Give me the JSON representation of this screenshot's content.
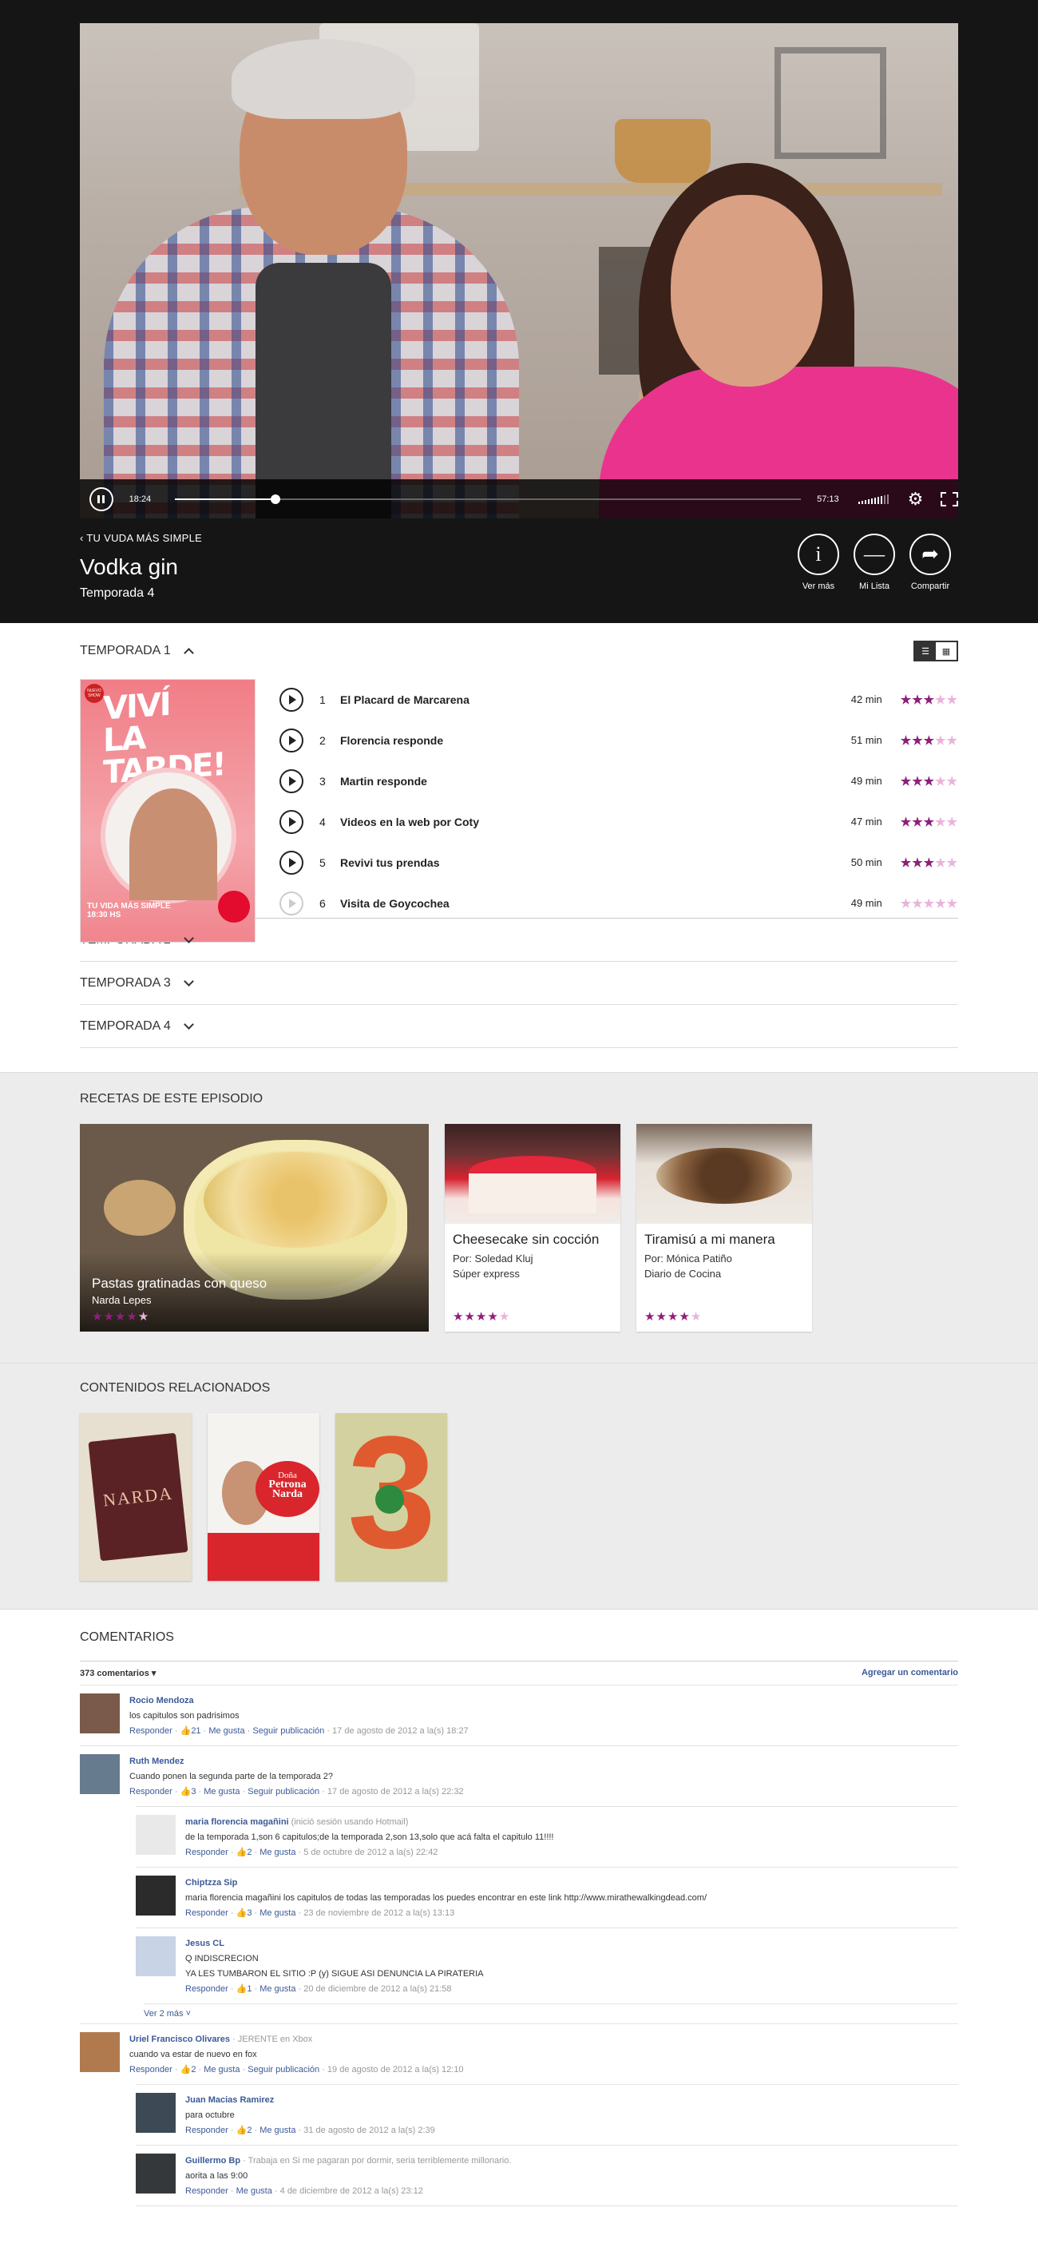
{
  "player": {
    "current_time": "18:24",
    "total_time": "57:13",
    "progress_fraction": 0.16
  },
  "show": {
    "back_label": "TU VUDA MÁS SIMPLE",
    "title": "Vodka gin",
    "season": "Temporada 4",
    "actions": [
      {
        "icon": "info-icon",
        "label": "Ver más"
      },
      {
        "icon": "minus-icon",
        "label": "Mi Lista"
      },
      {
        "icon": "share-icon",
        "label": "Compartir"
      }
    ]
  },
  "seasons": {
    "open_label": "TEMPORADA 1",
    "poster": {
      "badge": "NUEVO SHOW",
      "title_line1": "VIVÍ",
      "title_line2": "LA TARDE!",
      "footer_line1": "TU VIDA MÁS SIMPLE",
      "footer_line2": "18:30 HS"
    },
    "episodes": [
      {
        "num": "1",
        "name": "El Placard de Marcarena",
        "duration": "42 min",
        "rating": 3
      },
      {
        "num": "2",
        "name": "Florencia responde",
        "duration": "51 min",
        "rating": 3
      },
      {
        "num": "3",
        "name": "Martin responde",
        "duration": "49 min",
        "rating": 3
      },
      {
        "num": "4",
        "name": "Videos en la web por Coty",
        "duration": "47 min",
        "rating": 3
      },
      {
        "num": "5",
        "name": "Revivi tus prendas",
        "duration": "50 min",
        "rating": 3
      },
      {
        "num": "6",
        "name": "Visita de Goycochea",
        "duration": "49 min",
        "rating": 0
      }
    ],
    "collapsed": [
      "TEMPORADA 2",
      "TEMPORADA 3",
      "TEMPORADA 4"
    ]
  },
  "recipes": {
    "title": "RECETAS DE ESTE EPISODIO",
    "featured": {
      "name": "Pastas gratinadas con queso",
      "author": "Narda Lepes",
      "rating": 4
    },
    "cards": [
      {
        "name": "Cheesecake sin cocción",
        "author": "Por: Soledad Kluj",
        "source": "Súper express",
        "rating": 4
      },
      {
        "name": "Tiramisú a mi manera",
        "author": "Por: Mónica Patiño",
        "source": "Diario de Cocina",
        "rating": 4
      }
    ]
  },
  "related": {
    "title": "CONTENIDOS RELACIONADOS",
    "items": [
      {
        "label": "NARDA"
      },
      {
        "label1": "Doña",
        "label2": "Petrona",
        "label3": "Narda"
      },
      {
        "label": "3"
      }
    ]
  },
  "comments": {
    "title": "COMENTARIOS",
    "count": "373 comentarios ▾",
    "add_label": "Agregar un comentario",
    "responder": "Responder",
    "me_gusta": "Me gusta",
    "seguir": "Seguir publicación",
    "more_label": "Ver 2 más ˅",
    "items": [
      {
        "name": "Rocio Mendoza",
        "meta": "",
        "text": "los capitulos son padrisimos",
        "likes": "21",
        "date": "17 de agosto de 2012 a la(s) 18:27",
        "reply": false,
        "follow": true,
        "color": "#7a5a4a"
      },
      {
        "name": "Ruth Mendez",
        "meta": "",
        "text": "Cuando ponen la segunda parte de la temporada 2?",
        "likes": "3",
        "date": "17 de agosto de 2012 a la(s) 22:32",
        "reply": false,
        "follow": true,
        "color": "#667c8e"
      },
      {
        "name": "maria florencia magañini",
        "meta": "(inició sesión usando Hotmail)",
        "text": "de la temporada 1,son 6 capitulos;de la temporada 2,son 13,solo que acá falta el capitulo 11!!!!",
        "likes": "2",
        "date": "5 de octubre de 2012 a la(s) 22:42",
        "reply": true,
        "follow": false,
        "color": "#e9e9e9"
      },
      {
        "name": "Chiptzza Sip",
        "meta": "",
        "text": "maria florencia magañini los capitulos de todas las temporadas los puedes encontrar en este link http://www.mirathewalkingdead.com/",
        "likes": "3",
        "date": "23 de noviembre de 2012 a la(s) 13:13",
        "reply": true,
        "follow": false,
        "color": "#2b2b2b"
      },
      {
        "name": "Jesus CL",
        "meta": "",
        "text": "Q INDISCRECION\nYA LES TUMBARON EL SITIO :P (y) SIGUE ASI DENUNCIA LA PIRATERIA",
        "likes": "1",
        "date": "20 de diciembre de 2012 a la(s) 21:58",
        "reply": true,
        "follow": false,
        "color": "#c9d3e6"
      },
      {
        "name": "Uriel Francisco Olivares",
        "meta": "· JERENTE en Xbox",
        "text": "cuando va estar de nuevo en fox",
        "likes": "2",
        "date": "19 de agosto de 2012 a la(s) 12:10",
        "reply": false,
        "follow": true,
        "color": "#b07a4e"
      },
      {
        "name": "Juan Macias Ramirez",
        "meta": "",
        "text": "para octubre",
        "likes": "2",
        "date": "31 de agosto de 2012 a la(s) 2:39",
        "reply": true,
        "follow": false,
        "color": "#3d4a55"
      },
      {
        "name": "Guillermo Bp",
        "meta": "· Trabaja en Si me pagaran por dormir, seria terriblemente millonario.",
        "text": "aorita a las 9:00",
        "likes": "",
        "date": "4 de diciembre de 2012 a la(s) 23:12",
        "reply": true,
        "follow": false,
        "color": "#34383a"
      }
    ]
  }
}
